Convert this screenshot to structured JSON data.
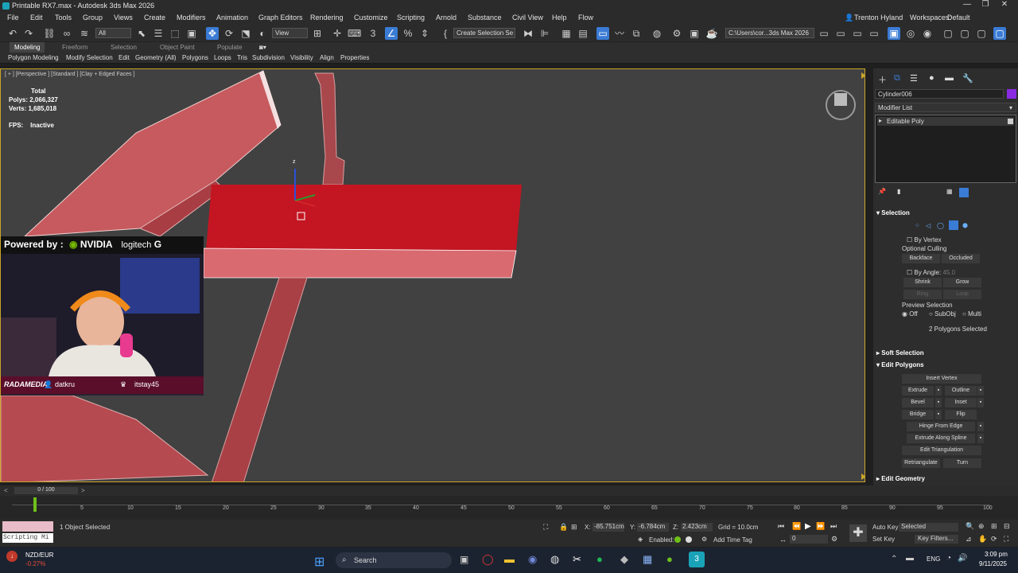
{
  "window": {
    "title": "Printable RX7.max - Autodesk 3ds Max 2026",
    "min": "—",
    "max": "❐",
    "close": "✕"
  },
  "menu": [
    "File",
    "Edit",
    "Tools",
    "Group",
    "Views",
    "Create",
    "Modifiers",
    "Animation",
    "Graph Editors",
    "Rendering",
    "Customize",
    "Scripting",
    "Arnold",
    "Substance",
    "Civil View",
    "Help",
    "Flow"
  ],
  "user": {
    "name": "Trenton Hyland",
    "workspaces_label": "Workspaces:",
    "workspace": "Default"
  },
  "toolbar": {
    "filter": "All",
    "ref_coord": "View",
    "named_sel": "Create Selection Se",
    "path": "C:\\Users\\cor...3ds Max 2026"
  },
  "ribbon_tabs": [
    "Modeling",
    "Freeform",
    "Selection",
    "Object Paint",
    "Populate"
  ],
  "ribbon_items": [
    "Polygon Modeling",
    "Modify Selection",
    "Edit",
    "Geometry (All)",
    "Polygons",
    "Loops",
    "Tris",
    "Subdivision",
    "Visibility",
    "Align",
    "Properties"
  ],
  "viewport": {
    "label": "[ + ] [Perspective ] [Standard ] [Clay + Edged Faces ]",
    "stats": {
      "total": "Total",
      "polys_label": "Polys:",
      "polys": "2,066,327",
      "verts_label": "Verts:",
      "verts": "1,685,018",
      "fps_label": "FPS:",
      "fps": "Inactive"
    },
    "gizmo_z": "z"
  },
  "webcam": {
    "powered": "Powered by :",
    "nvidia": "NVIDIA",
    "logitech": "logitech",
    "brand": "RADAMEDIA",
    "user1": "datkru",
    "user2": "itstay45"
  },
  "command_panel": {
    "object_name": "Cylinder006",
    "modifier_list": "Modifier List",
    "stack_item": "Editable Poly",
    "selection": "Selection",
    "by_vertex": "By Vertex",
    "optional_culling": "Optional Culling",
    "backface": "Backface",
    "occluded": "Occluded",
    "by_angle": "By Angle:",
    "angle": "45.0",
    "shrink": "Shrink",
    "grow": "Grow",
    "ring": "Ring",
    "loop": "Loop",
    "preview_selection": "Preview Selection",
    "off": "Off",
    "subobj": "SubObj",
    "multi": "Multi",
    "selected_info": "2 Polygons Selected",
    "soft_selection": "Soft Selection",
    "edit_polygons": "Edit Polygons",
    "insert_vertex": "Insert Vertex",
    "extrude": "Extrude",
    "outline": "Outline",
    "bevel": "Bevel",
    "inset": "Inset",
    "bridge": "Bridge",
    "flip": "Flip",
    "hinge": "Hinge From Edge",
    "extrude_spline": "Extrude Along Spline",
    "edit_triangulation": "Edit Triangulation",
    "retriangulate": "Retriangulate",
    "turn": "Turn",
    "edit_geometry": "Edit Geometry"
  },
  "timeline": {
    "frame": "0 / 100",
    "ticks": [
      "5",
      "10",
      "15",
      "20",
      "25",
      "30",
      "35",
      "40",
      "45",
      "50",
      "55",
      "60",
      "65",
      "70",
      "75",
      "80",
      "85",
      "90",
      "95",
      "100"
    ]
  },
  "status": {
    "objects": "1 Object Selected",
    "script": "Scripting Mi",
    "x_label": "X:",
    "x": "-85.751cm",
    "y_label": "Y:",
    "y": "-6.784cm",
    "z_label": "Z:",
    "z": "2.423cm",
    "grid": "Grid = 10.0cm",
    "enabled": "Enabled:",
    "add_time_tag": "Add Time Tag",
    "auto_key": "Auto Key",
    "selected": "Selected",
    "set_key": "Set Key",
    "key_filters": "Key Filters...",
    "frame_field": "0"
  },
  "taskbar": {
    "ticker": "NZD/EUR",
    "change": "-0.27%",
    "search": "Search",
    "lang": "ENG",
    "time": "3:09 pm",
    "date": "9/11/2025"
  },
  "colors": {
    "accent": "#3a7bd5",
    "model": "#c31622",
    "viewport_border": "#c8a628"
  }
}
